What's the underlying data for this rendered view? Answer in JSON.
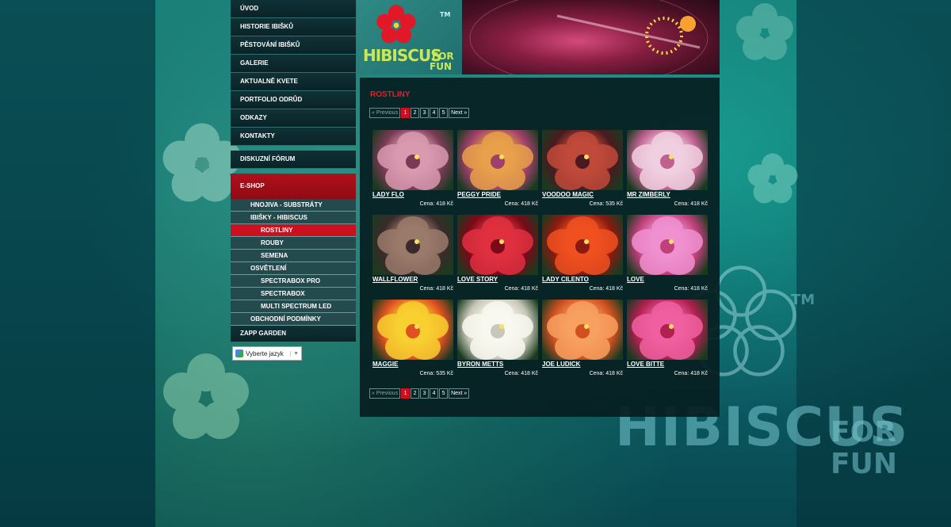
{
  "brand": {
    "logo_word1": "HIBISCUS",
    "logo_word2": "FOR",
    "logo_word3": "FUN",
    "trademark": "TM",
    "colors": {
      "accent": "#cc1020",
      "nav_bg": "#0a2428",
      "content_bg": "#061e20"
    }
  },
  "nav": {
    "items": [
      {
        "label": "ÚVOD"
      },
      {
        "label": "HISTORIE IBIŠKŮ"
      },
      {
        "label": "PĚSTOVÁNÍ IBIŠKŮ"
      },
      {
        "label": "GALERIE"
      },
      {
        "label": "AKTUALNĚ KVETE"
      },
      {
        "label": "PORTFOLIO ODRŮD"
      },
      {
        "label": "ODKAZY"
      },
      {
        "label": "KONTAKTY"
      }
    ],
    "forum": "DISKUZNÍ FÓRUM",
    "eshop": "E-SHOP",
    "eshop_sub": [
      {
        "label": "HNOJIVA - SUBSTRÁTY",
        "level": 1
      },
      {
        "label": "IBIŠKY - HIBISCUS",
        "level": 1
      },
      {
        "label": "ROSTLINY",
        "level": 2,
        "active": true
      },
      {
        "label": "ROUBY",
        "level": 2
      },
      {
        "label": "SEMENA",
        "level": 2
      },
      {
        "label": "OSVĚTLENÍ",
        "level": 1
      },
      {
        "label": "SPECTRABOX PRO",
        "level": 2
      },
      {
        "label": "SPECTRABOX",
        "level": 2
      },
      {
        "label": "MULTI SPECTRUM LED",
        "level": 2
      },
      {
        "label": "OBCHODNÍ PODMÍNKY",
        "level": 1
      }
    ],
    "zapp": "ZAPP GARDEN",
    "language_select": "Vyberte jazyk"
  },
  "content": {
    "title": "ROSTLINY",
    "pager": {
      "prev": "« Previous",
      "pages": [
        "1",
        "2",
        "3",
        "4",
        "5"
      ],
      "current": "1",
      "next": "Next »"
    },
    "products": [
      {
        "name": "LADY FLO",
        "price": "Cena: 418 Kč",
        "c1": "#d99ab0",
        "c2": "#7a3a55"
      },
      {
        "name": "PEGGY PRIDE",
        "price": "Cena: 418 Kč",
        "c1": "#e8a04a",
        "c2": "#a0406a"
      },
      {
        "name": "VOODOO MAGIC",
        "price": "Cena: 535 Kč",
        "c1": "#c04a3a",
        "c2": "#4a1a20"
      },
      {
        "name": "MR ZIMBERLY",
        "price": "Cena: 418 Kč",
        "c1": "#f0d0e0",
        "c2": "#c06090"
      },
      {
        "name": "WALLFLOWER",
        "price": "Cena: 418 Kč",
        "c1": "#9a7a6a",
        "c2": "#3a2a2a"
      },
      {
        "name": "LOVE STORY",
        "price": "Cena: 418 Kč",
        "c1": "#e03040",
        "c2": "#7a0a18"
      },
      {
        "name": "LADY CILENTO",
        "price": "Cena: 418 Kč",
        "c1": "#f05020",
        "c2": "#8a1a10"
      },
      {
        "name": "LOVE",
        "price": "Cena: 418 Kč",
        "c1": "#f090d0",
        "c2": "#c0407a"
      },
      {
        "name": "MAGGIE",
        "price": "Cena: 535 Kč",
        "c1": "#f8d030",
        "c2": "#e05020"
      },
      {
        "name": "BYRON METTS",
        "price": "Cena: 418 Kč",
        "c1": "#f8f8f0",
        "c2": "#c8c8b8"
      },
      {
        "name": "JOE LUDICK",
        "price": "Cena: 418 Kč",
        "c1": "#f8a060",
        "c2": "#d05020"
      },
      {
        "name": "LOVE BITTE",
        "price": "Cena: 418 Kč",
        "c1": "#f060a0",
        "c2": "#b02050"
      }
    ]
  },
  "watermark": {
    "word1": "HIBISCUS",
    "word2": "FOR",
    "word3": "FUN",
    "tm": "TM"
  }
}
